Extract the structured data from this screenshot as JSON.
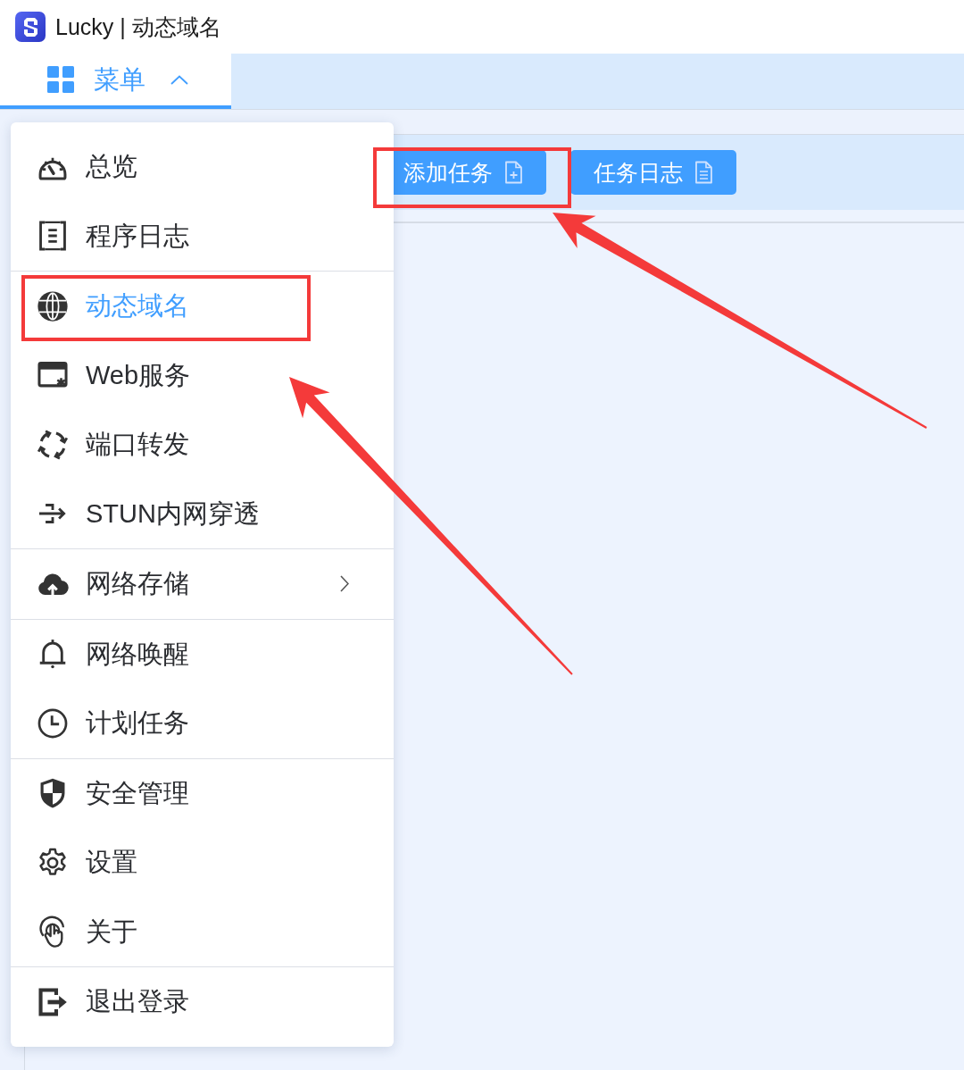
{
  "window": {
    "title": "Lucky | 动态域名"
  },
  "tabs": [
    {
      "label": "菜单",
      "selected": true,
      "expanded": true
    }
  ],
  "toolbar": {
    "buttons": [
      {
        "label": "添加任务"
      },
      {
        "label": "任务日志"
      }
    ]
  },
  "menu": {
    "groups": [
      {
        "items": [
          {
            "label": "总览",
            "selected": false,
            "submenu": false
          },
          {
            "label": "程序日志",
            "selected": false,
            "submenu": false
          }
        ]
      },
      {
        "items": [
          {
            "label": "动态域名",
            "selected": true,
            "submenu": false
          },
          {
            "label": "Web服务",
            "selected": false,
            "submenu": false
          },
          {
            "label": "端口转发",
            "selected": false,
            "submenu": false
          },
          {
            "label": "STUN内网穿透",
            "selected": false,
            "submenu": false
          }
        ]
      },
      {
        "items": [
          {
            "label": "网络存储",
            "selected": false,
            "submenu": true
          }
        ]
      },
      {
        "items": [
          {
            "label": "网络唤醒",
            "selected": false,
            "submenu": false
          },
          {
            "label": "计划任务",
            "selected": false,
            "submenu": false
          }
        ]
      },
      {
        "items": [
          {
            "label": "安全管理",
            "selected": false,
            "submenu": false
          },
          {
            "label": "设置",
            "selected": false,
            "submenu": false
          },
          {
            "label": "关于",
            "selected": false,
            "submenu": false
          }
        ]
      },
      {
        "items": [
          {
            "label": "退出登录",
            "selected": false,
            "submenu": false
          }
        ]
      }
    ]
  },
  "annotations": [
    {
      "kind": "frame"
    },
    {
      "kind": "frame"
    },
    {
      "kind": "arrow"
    },
    {
      "kind": "arrow"
    }
  ]
}
